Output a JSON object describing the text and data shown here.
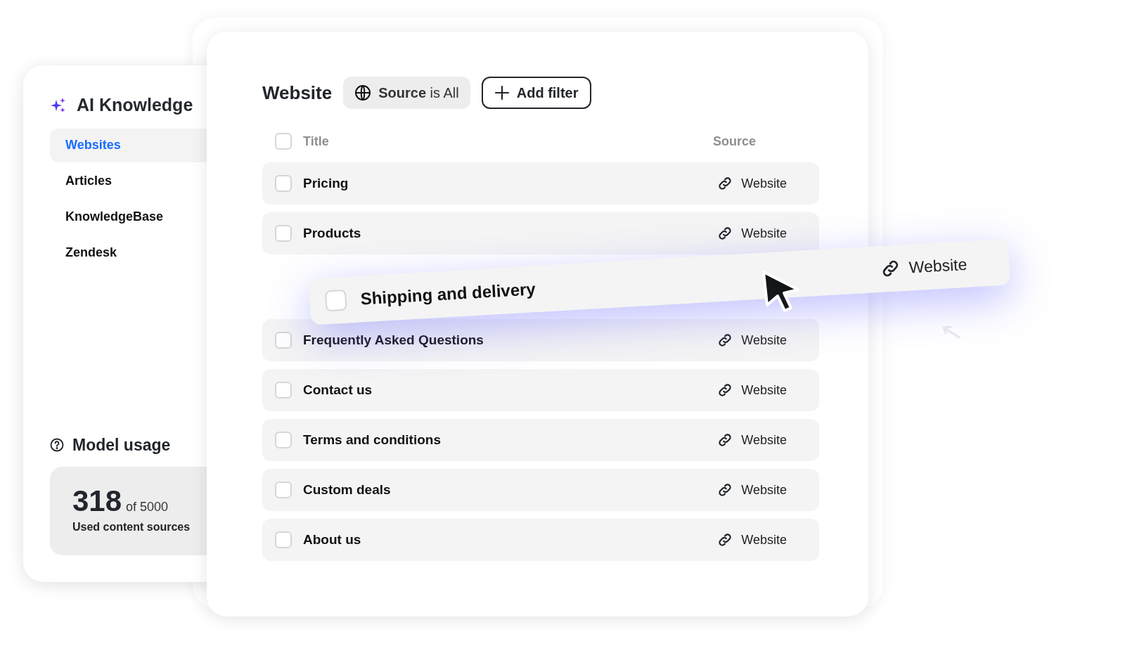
{
  "sidebar": {
    "title": "AI Knowledge",
    "items": [
      {
        "label": "Websites",
        "selected": true
      },
      {
        "label": "Articles",
        "selected": false
      },
      {
        "label": "KnowledgeBase",
        "selected": false
      },
      {
        "label": "Zendesk",
        "selected": false
      }
    ]
  },
  "usage": {
    "title": "Model usage",
    "count": "318",
    "total": "of 5000",
    "caption": "Used content sources"
  },
  "table": {
    "title": "Website",
    "filter": "**Source** is All",
    "add_filter": "Add filter",
    "columns": [
      "Title",
      "Source"
    ],
    "header_checked": false,
    "rows": [
      {
        "kind": "row",
        "title": "Pricing",
        "source": "Website",
        "checked": false
      },
      {
        "kind": "row",
        "title": "Products",
        "source": "Website",
        "checked": false
      },
      {
        "kind": "slot"
      },
      {
        "kind": "row",
        "title": "Frequently Asked Questions",
        "source": "Website",
        "checked": false
      },
      {
        "kind": "row",
        "title": "Contact us",
        "source": "Website",
        "checked": false
      },
      {
        "kind": "row",
        "title": "Terms and conditions",
        "source": "Website",
        "checked": false
      },
      {
        "kind": "row",
        "title": "Custom deals",
        "source": "Website",
        "checked": false
      },
      {
        "kind": "row",
        "title": "About us",
        "source": "Website",
        "checked": false
      }
    ]
  },
  "dragged_row": {
    "title": "Shipping and delivery",
    "source": "Website",
    "checked": false
  }
}
